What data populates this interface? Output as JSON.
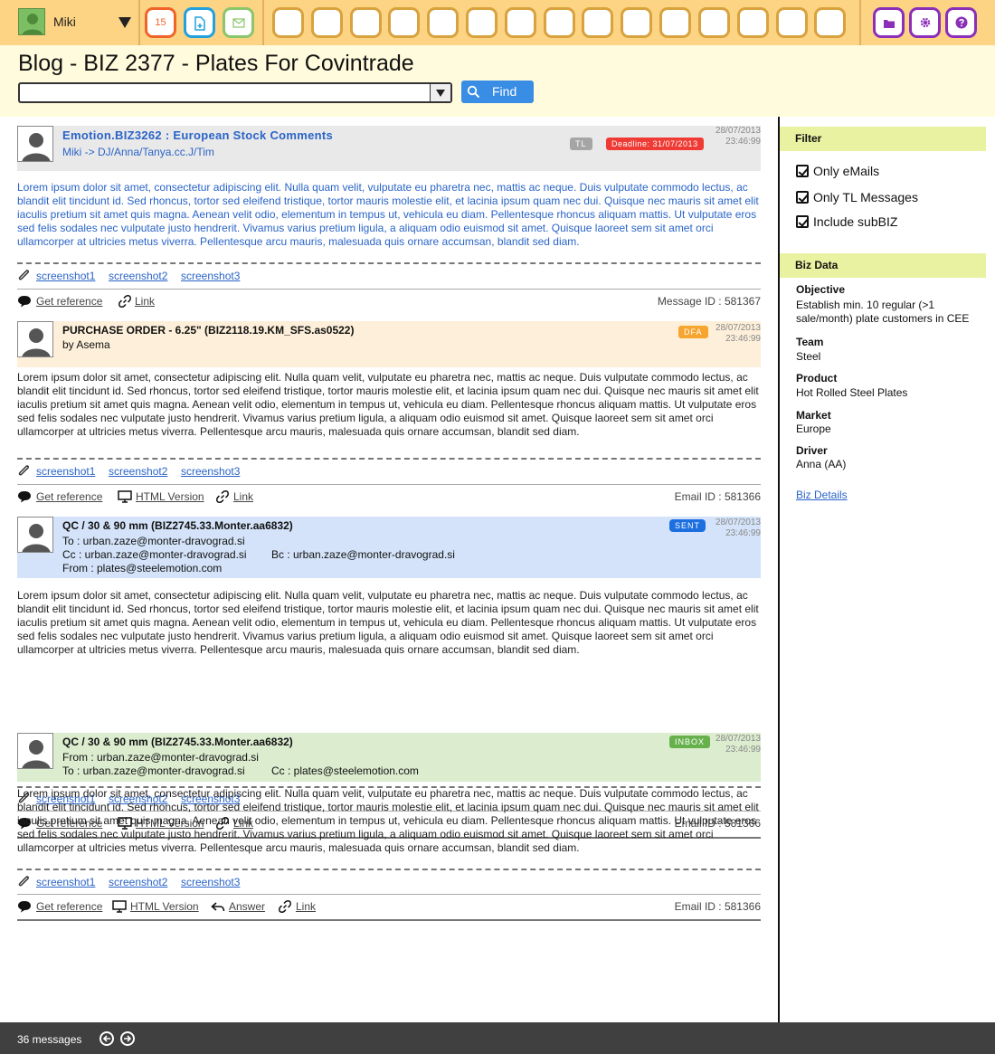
{
  "user": {
    "name": "Miki"
  },
  "toolbar": {
    "calendar_day": "15"
  },
  "page": {
    "title": "Blog - BIZ 2377 - Plates For Covintrade"
  },
  "search": {
    "value": "",
    "find_label": "Find"
  },
  "posts": [
    {
      "title": "Emotion.BIZ3262 : European Stock Comments",
      "meta": "Miki -> DJ/Anna/Tanya.cc.J/Tim",
      "badge_tl": "TL",
      "badge_deadline": "Deadline: 31/07/2013",
      "date": "28/07/2013",
      "time": "23:46:99",
      "body": "Lorem ipsum dolor sit amet, consectetur adipiscing elit. Nulla quam velit, vulputate eu pharetra nec, mattis ac neque. Duis vulputate commodo lectus, ac blandit elit tincidunt id. Sed rhoncus, tortor sed eleifend tristique, tortor mauris molestie elit, et lacinia ipsum quam nec dui. Quisque nec mauris sit amet elit iaculis pretium sit amet quis magna. Aenean velit odio, elementum in tempus ut, vehicula eu diam. Pellentesque rhoncus aliquam mattis. Ut vulputate eros sed felis sodales nec vulputate justo hendrerit. Vivamus varius pretium ligula, a aliquam odio euismod sit amet. Quisque laoreet sem sit amet orci ullamcorper at ultricies metus viverra. Pellentesque arcu mauris, malesuada quis ornare accumsan, blandit sed diam.",
      "attachments": [
        "screenshot1",
        "screenshot2",
        "screenshot3"
      ],
      "actions": {
        "reference": "Get reference",
        "link": "Link"
      },
      "id_text": "Message ID : 581367"
    },
    {
      "title": "PURCHASE ORDER - 6.25\" (BIZ2118.19.KM_SFS.as0522)",
      "meta": "by Asema",
      "badge": "DFA",
      "date": "28/07/2013",
      "time": "23:46:99",
      "body": "Lorem ipsum dolor sit amet, consectetur adipiscing elit. Nulla quam velit, vulputate eu pharetra nec, mattis ac neque. Duis vulputate commodo lectus, ac blandit elit tincidunt id. Sed rhoncus, tortor sed eleifend tristique, tortor mauris molestie elit, et lacinia ipsum quam nec dui. Quisque nec mauris sit amet elit iaculis pretium sit amet quis magna. Aenean velit odio, elementum in tempus ut, vehicula eu diam. Pellentesque rhoncus aliquam mattis. Ut vulputate eros sed felis sodales nec vulputate justo hendrerit. Vivamus varius pretium ligula, a aliquam odio euismod sit amet. Quisque laoreet sem sit amet orci ullamcorper at ultricies metus viverra. Pellentesque arcu mauris, malesuada quis ornare accumsan, blandit sed diam.",
      "attachments": [
        "screenshot1",
        "screenshot2",
        "screenshot3"
      ],
      "actions": {
        "reference": "Get reference",
        "html": "HTML Version",
        "link": "Link"
      },
      "id_text": "Email ID : 581366"
    },
    {
      "title": "QC / 30 & 90 mm (BIZ2745.33.Monter.aa6832)",
      "to": "To : urban.zaze@monter-dravograd.si",
      "cc": "Cc : urban.zaze@monter-dravograd.si",
      "bc": "Bc : urban.zaze@monter-dravograd.si",
      "from": "From : plates@steelemotion.com",
      "badge": "SENT",
      "date": "28/07/2013",
      "time": "23:46:99",
      "body": "Lorem ipsum dolor sit amet, consectetur adipiscing elit. Nulla quam velit, vulputate eu pharetra nec, mattis ac neque. Duis vulputate commodo lectus, ac blandit elit tincidunt id. Sed rhoncus, tortor sed eleifend tristique, tortor mauris molestie elit, et lacinia ipsum quam nec dui. Quisque nec mauris sit amet elit iaculis pretium sit amet quis magna. Aenean velit odio, elementum in tempus ut, vehicula eu diam. Pellentesque rhoncus aliquam mattis. Ut vulputate eros sed felis sodales nec vulputate justo hendrerit. Vivamus varius pretium ligula, a aliquam odio euismod sit amet. Quisque laoreet sem sit amet orci ullamcorper at ultricies metus viverra. Pellentesque arcu mauris, malesuada quis ornare accumsan, blandit sed diam.",
      "attachments": [
        "screenshot1",
        "screenshot2",
        "screenshot3"
      ],
      "actions": {
        "reference": "Get reference",
        "html": "HTML Version",
        "link": "Link"
      },
      "id_text": "Email ID : 581366"
    },
    {
      "title": "QC / 30 & 90 mm (BIZ2745.33.Monter.aa6832)",
      "from": "From : urban.zaze@monter-dravograd.si",
      "to": "To : urban.zaze@monter-dravograd.si",
      "cc": "Cc : plates@steelemotion.com",
      "badge": "INBOX",
      "date": "28/07/2013",
      "time": "23:46:99",
      "body": "Lorem ipsum dolor sit amet, consectetur adipiscing elit. Nulla quam velit, vulputate eu pharetra nec, mattis ac neque. Duis vulputate commodo lectus, ac blandit elit tincidunt id. Sed rhoncus, tortor sed eleifend tristique, tortor mauris molestie elit, et lacinia ipsum quam nec dui. Quisque nec mauris sit amet elit iaculis pretium sit amet quis magna. Aenean velit odio, elementum in tempus ut, vehicula eu diam. Pellentesque rhoncus aliquam mattis. Ut vulputate eros sed felis sodales nec vulputate justo hendrerit. Vivamus varius pretium ligula, a aliquam odio euismod sit amet. Quisque laoreet sem sit amet orci ullamcorper at ultricies metus viverra. Pellentesque arcu mauris, malesuada quis ornare accumsan, blandit sed diam.",
      "attachments": [
        "screenshot1",
        "screenshot2",
        "screenshot3"
      ],
      "actions": {
        "reference": "Get reference",
        "html": "HTML Version",
        "answer": "Answer",
        "link": "Link"
      },
      "id_text": "Email ID : 581366"
    }
  ],
  "sidebar": {
    "filter_title": "Filter",
    "filters": [
      {
        "label": "Only eMails",
        "checked": true
      },
      {
        "label": "Only TL Messages",
        "checked": true
      },
      {
        "label": "Include subBIZ",
        "checked": true
      }
    ],
    "biz_title": "Biz Data",
    "objective_label": "Objective",
    "objective": "Establish min. 10 regular (>1 sale/month) plate customers in CEE",
    "team_label": "Team",
    "team": "Steel",
    "product_label": "Product",
    "product": "Hot Rolled Steel Plates",
    "market_label": "Market",
    "market": "Europe",
    "driver_label": "Driver",
    "driver": "Anna (AA)",
    "details_link": "Biz Details"
  },
  "footer": {
    "count": "36 messages"
  },
  "colors": {
    "topbar": "#fcd484",
    "header": "#fffbdc",
    "badge_tl": "#a5a5a5",
    "badge_deadline": "#ef3b34",
    "badge_dfa": "#f6a52f",
    "badge_sent": "#1d6fe0",
    "badge_inbox": "#67b14c",
    "post2_bg": "#fdefd9",
    "post3_bg": "#d4e3f9",
    "post4_bg": "#dceccf"
  }
}
